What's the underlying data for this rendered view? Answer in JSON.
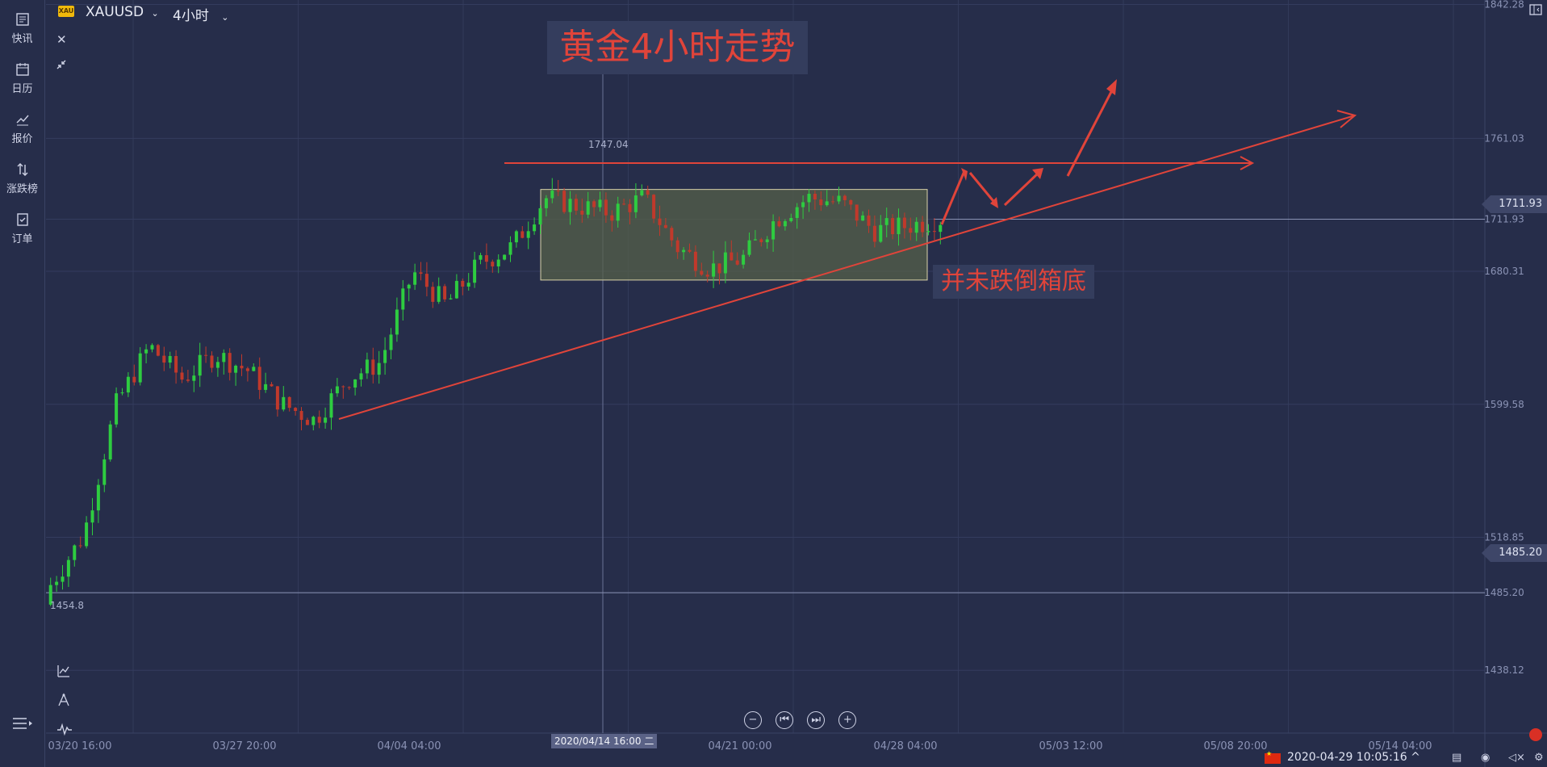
{
  "sidebar": {
    "items": [
      {
        "label": "快讯",
        "icon": "news-icon"
      },
      {
        "label": "日历",
        "icon": "calendar-icon"
      },
      {
        "label": "报价",
        "icon": "quote-chart-icon"
      },
      {
        "label": "涨跌榜",
        "icon": "up-down-icon"
      },
      {
        "label": "订单",
        "icon": "order-icon"
      }
    ],
    "bottom": {
      "icon": "menu-expand-icon"
    }
  },
  "toolbar": {
    "symbol_badge": "XAU",
    "symbol": "XAUUSD",
    "timeframe": "4小时",
    "left_tools": [
      "close-icon",
      "collapse-icon"
    ],
    "bottom_tools": [
      "indicator-icon",
      "draw-tool-icon",
      "pulse-icon"
    ]
  },
  "annotations": {
    "title": "黄金4小时走势",
    "note": "并未跌倒箱底",
    "high_label": "1747.04",
    "low_label": "1454.8"
  },
  "price_axis": {
    "labels": [
      "1842.28",
      "1761.03",
      "1711.93",
      "1680.31",
      "1599.58",
      "1518.85",
      "1485.20",
      "1438.12"
    ],
    "current_price": "1711.93",
    "crosshair_price": "1485.20"
  },
  "time_axis": {
    "labels": [
      "03/20 16:00",
      "03/27 20:00",
      "04/04 04:00",
      "04/21 00:00",
      "04/28 04:00",
      "05/03 12:00",
      "05/08 20:00",
      "05/14 04:00"
    ],
    "cursor_time": "2020/04/14 16:00 二"
  },
  "nav": [
    "zoom-out-icon",
    "jump-start-icon",
    "jump-end-icon",
    "zoom-in-icon"
  ],
  "status": {
    "datetime": "2020-04-29 10:05:16",
    "icons": [
      "layers-icon",
      "camera-icon",
      "mute-icon",
      "settings-icon"
    ]
  },
  "colors": {
    "background": "#262d4a",
    "up": "#2ecc40",
    "down": "#c0392b",
    "annotation": "#e0443a",
    "box_fill": "#55604a"
  },
  "chart_data": {
    "type": "candlestick",
    "symbol": "XAUUSD",
    "interval": "4小时",
    "ylim": [
      1400,
      1845
    ],
    "box": {
      "top": 1730,
      "bottom": 1675,
      "from": "04/08",
      "to": "04/28"
    },
    "support_line": {
      "from": [
        "04/02",
        1581
      ],
      "to": [
        "04/29",
        1700
      ]
    },
    "resistance_line": 1730,
    "candles_approx": [
      {
        "t": "03/20",
        "o": 1478,
        "h": 1498,
        "l": 1454.8,
        "c": 1490
      },
      {
        "t": "03/23",
        "o": 1490,
        "h": 1530,
        "l": 1480,
        "c": 1520
      },
      {
        "t": "03/24",
        "o": 1520,
        "h": 1612,
        "l": 1500,
        "c": 1600
      },
      {
        "t": "03/25",
        "o": 1600,
        "h": 1650,
        "l": 1590,
        "c": 1635
      },
      {
        "t": "03/26",
        "o": 1635,
        "h": 1645,
        "l": 1600,
        "c": 1615
      },
      {
        "t": "03/27",
        "o": 1615,
        "h": 1640,
        "l": 1605,
        "c": 1630
      },
      {
        "t": "03/30",
        "o": 1630,
        "h": 1636,
        "l": 1612,
        "c": 1620
      },
      {
        "t": "03/31",
        "o": 1620,
        "h": 1630,
        "l": 1590,
        "c": 1600
      },
      {
        "t": "04/01",
        "o": 1600,
        "h": 1605,
        "l": 1578,
        "c": 1590
      },
      {
        "t": "04/02",
        "o": 1590,
        "h": 1620,
        "l": 1580,
        "c": 1615
      },
      {
        "t": "04/03",
        "o": 1615,
        "h": 1630,
        "l": 1605,
        "c": 1625
      },
      {
        "t": "04/06",
        "o": 1625,
        "h": 1690,
        "l": 1620,
        "c": 1680
      },
      {
        "t": "04/07",
        "o": 1680,
        "h": 1685,
        "l": 1650,
        "c": 1660
      },
      {
        "t": "04/08",
        "o": 1660,
        "h": 1690,
        "l": 1650,
        "c": 1685
      },
      {
        "t": "04/09",
        "o": 1685,
        "h": 1700,
        "l": 1680,
        "c": 1695
      },
      {
        "t": "04/13",
        "o": 1695,
        "h": 1740,
        "l": 1690,
        "c": 1725
      },
      {
        "t": "04/14",
        "o": 1725,
        "h": 1747.04,
        "l": 1715,
        "c": 1720
      },
      {
        "t": "04/15",
        "o": 1720,
        "h": 1728,
        "l": 1712,
        "c": 1716
      },
      {
        "t": "04/16",
        "o": 1716,
        "h": 1732,
        "l": 1710,
        "c": 1725
      },
      {
        "t": "04/17",
        "o": 1725,
        "h": 1728,
        "l": 1690,
        "c": 1695
      },
      {
        "t": "04/20",
        "o": 1695,
        "h": 1700,
        "l": 1675,
        "c": 1682
      },
      {
        "t": "04/21",
        "o": 1682,
        "h": 1692,
        "l": 1662,
        "c": 1688
      },
      {
        "t": "04/22",
        "o": 1688,
        "h": 1715,
        "l": 1685,
        "c": 1712
      },
      {
        "t": "04/23",
        "o": 1712,
        "h": 1730,
        "l": 1705,
        "c": 1725
      },
      {
        "t": "04/24",
        "o": 1725,
        "h": 1732,
        "l": 1718,
        "c": 1722
      },
      {
        "t": "04/27",
        "o": 1722,
        "h": 1724,
        "l": 1700,
        "c": 1705
      },
      {
        "t": "04/28",
        "o": 1705,
        "h": 1712,
        "l": 1690,
        "c": 1708
      },
      {
        "t": "04/29",
        "o": 1708,
        "h": 1715,
        "l": 1700,
        "c": 1711.93
      }
    ]
  }
}
